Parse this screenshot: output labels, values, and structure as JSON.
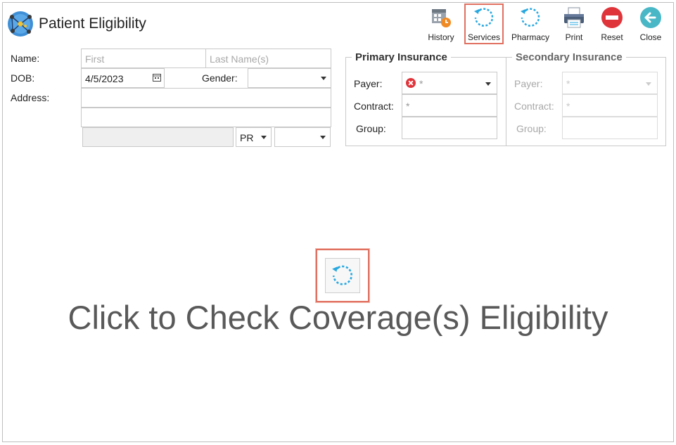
{
  "app": {
    "title": "Patient Eligibility"
  },
  "toolbar": {
    "history": "History",
    "services": "Services",
    "pharmacy": "Pharmacy",
    "print": "Print",
    "reset": "Reset",
    "close": "Close"
  },
  "patient": {
    "name_label": "Name:",
    "first_placeholder": "First",
    "last_placeholder": "Last Name(s)",
    "dob_label": "DOB:",
    "dob_value": "4/5/2023",
    "gender_label": "Gender:",
    "gender_value": "",
    "address_label": "Address:",
    "address_line1": "",
    "address_line2": "",
    "city": "",
    "state": "PR",
    "zip": ""
  },
  "primary_insurance": {
    "title": "Primary Insurance",
    "payer_label": "Payer:",
    "payer_value": "*",
    "contract_label": "Contract:",
    "contract_value": "*",
    "group_label": "Group:",
    "group_value": ""
  },
  "secondary_insurance": {
    "title": "Secondary Insurance",
    "payer_label": "Payer:",
    "payer_value": "*",
    "contract_label": "Contract:",
    "contract_value": "*",
    "group_label": "Group:",
    "group_value": ""
  },
  "main": {
    "check_caption": "Click to Check Coverage(s) Eligibility"
  },
  "colors": {
    "accent_blue": "#29a8e0",
    "highlight_red": "#e07060",
    "error_red": "#e0343b"
  }
}
